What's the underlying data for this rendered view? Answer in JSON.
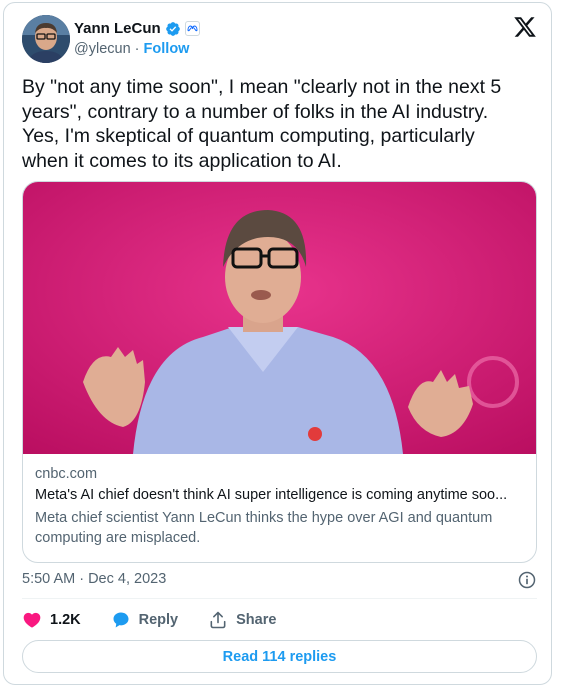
{
  "author": {
    "name": "Yann LeCun",
    "handle": "@ylecun",
    "separator": "·",
    "follow_label": "Follow"
  },
  "tweet": {
    "text": "By \"not any time soon\", I mean \"clearly not in the next 5\nyears\", contrary to a number of folks in the AI industry.\nYes, I'm skeptical of quantum computing, particularly\nwhen it comes to its application to AI.",
    "timestamp": "5:50 AM · Dec 4, 2023"
  },
  "link_card": {
    "domain": "cnbc.com",
    "title": "Meta's AI chief doesn't think AI super intelligence is coming anytime soo...",
    "description": "Meta chief scientist Yann LeCun thinks the hype over AGI and quantum computing are misplaced."
  },
  "actions": {
    "likes": "1.2K",
    "reply_label": "Reply",
    "share_label": "Share"
  },
  "read_replies_label": "Read 114 replies",
  "colors": {
    "accent": "#1d9bf0",
    "like": "#f91880",
    "text_secondary": "#536471",
    "border": "#cfd9de",
    "media_background": "#d1166e"
  },
  "icons": {
    "verified": "verified-badge-icon",
    "affiliation": "meta-affiliation-icon",
    "platform": "x-logo-icon",
    "info": "info-icon",
    "like": "heart-icon",
    "reply": "speech-bubble-icon",
    "share": "share-upload-icon"
  }
}
